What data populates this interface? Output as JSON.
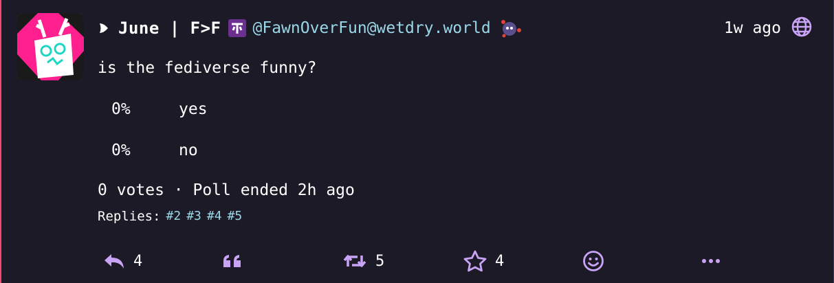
{
  "post": {
    "display_name": "June | F>F",
    "handle": "@FawnOverFun@wetdry.world",
    "timestamp": "1w ago",
    "content": "is the fediverse funny?",
    "poll": {
      "options": [
        {
          "percent": "0%",
          "label": "yes"
        },
        {
          "percent": "0%",
          "label": "no"
        }
      ],
      "footer": "0 votes · Poll ended 2h ago"
    },
    "replies_label": "Replies:",
    "replies": [
      "#2",
      "#3",
      "#4",
      "#5"
    ]
  },
  "actions": {
    "reply_count": "4",
    "boost_count": "5",
    "favourite_count": "4"
  },
  "colors": {
    "background": "#1c1a26",
    "accent": "#c9a4f6",
    "handle": "#9ad7e6",
    "border": "#f84a6e",
    "avatar_pink": "#ff1f8e"
  },
  "icons": [
    "heart-icon",
    "pronoun-badge-icon",
    "instance-emoji-icon",
    "globe-icon",
    "reply-icon",
    "quote-icon",
    "boost-icon",
    "star-icon",
    "emoji-react-icon",
    "more-icon"
  ]
}
